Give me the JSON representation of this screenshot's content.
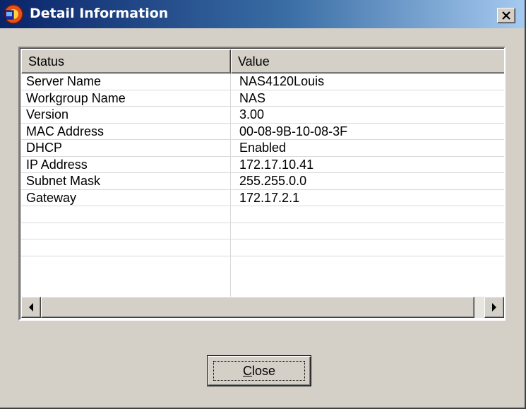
{
  "window": {
    "title": "Detail Information",
    "app_icon": "app-icon",
    "close_icon": "close-icon"
  },
  "table": {
    "columns": [
      "Status",
      "Value"
    ],
    "rows": [
      {
        "status": "Server Name",
        "value": "NAS4120Louis"
      },
      {
        "status": "Workgroup Name",
        "value": "NAS"
      },
      {
        "status": "Version",
        "value": "3.00"
      },
      {
        "status": "MAC Address",
        "value": "00-08-9B-10-08-3F"
      },
      {
        "status": "DHCP",
        "value": "Enabled"
      },
      {
        "status": "IP Address",
        "value": "172.17.10.41"
      },
      {
        "status": "Subnet Mask",
        "value": "255.255.0.0"
      },
      {
        "status": "Gateway",
        "value": "172.17.2.1"
      },
      {
        "status": "",
        "value": ""
      },
      {
        "status": "",
        "value": ""
      },
      {
        "status": "",
        "value": ""
      },
      {
        "status": "",
        "value": ""
      }
    ]
  },
  "scrollbar": {
    "left_icon": "arrow-left-icon",
    "right_icon": "arrow-right-icon"
  },
  "buttons": {
    "close_label_mnemonic": "C",
    "close_label_rest": "lose"
  },
  "colors": {
    "title_gradient_start": "#0a246a",
    "title_gradient_end": "#a6caf0",
    "face": "#d4d0c8"
  }
}
